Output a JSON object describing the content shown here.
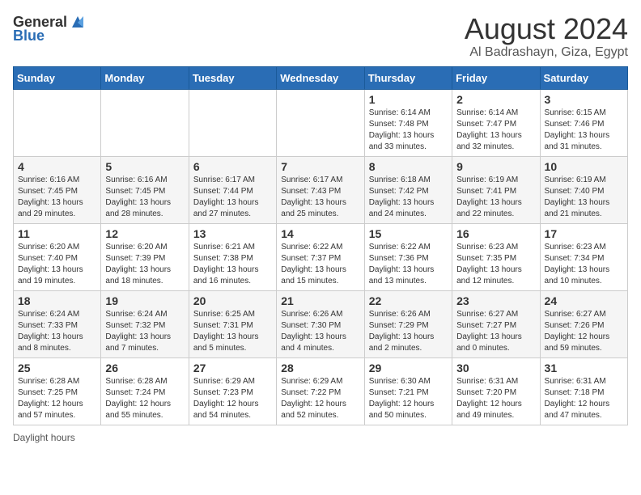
{
  "header": {
    "logo_general": "General",
    "logo_blue": "Blue",
    "title": "August 2024",
    "subtitle": "Al Badrashayn, Giza, Egypt"
  },
  "days_of_week": [
    "Sunday",
    "Monday",
    "Tuesday",
    "Wednesday",
    "Thursday",
    "Friday",
    "Saturday"
  ],
  "footer": {
    "daylight_label": "Daylight hours"
  },
  "weeks": [
    [
      {
        "day": "",
        "info": ""
      },
      {
        "day": "",
        "info": ""
      },
      {
        "day": "",
        "info": ""
      },
      {
        "day": "",
        "info": ""
      },
      {
        "day": "1",
        "info": "Sunrise: 6:14 AM\nSunset: 7:48 PM\nDaylight: 13 hours and 33 minutes."
      },
      {
        "day": "2",
        "info": "Sunrise: 6:14 AM\nSunset: 7:47 PM\nDaylight: 13 hours and 32 minutes."
      },
      {
        "day": "3",
        "info": "Sunrise: 6:15 AM\nSunset: 7:46 PM\nDaylight: 13 hours and 31 minutes."
      }
    ],
    [
      {
        "day": "4",
        "info": "Sunrise: 6:16 AM\nSunset: 7:45 PM\nDaylight: 13 hours and 29 minutes."
      },
      {
        "day": "5",
        "info": "Sunrise: 6:16 AM\nSunset: 7:45 PM\nDaylight: 13 hours and 28 minutes."
      },
      {
        "day": "6",
        "info": "Sunrise: 6:17 AM\nSunset: 7:44 PM\nDaylight: 13 hours and 27 minutes."
      },
      {
        "day": "7",
        "info": "Sunrise: 6:17 AM\nSunset: 7:43 PM\nDaylight: 13 hours and 25 minutes."
      },
      {
        "day": "8",
        "info": "Sunrise: 6:18 AM\nSunset: 7:42 PM\nDaylight: 13 hours and 24 minutes."
      },
      {
        "day": "9",
        "info": "Sunrise: 6:19 AM\nSunset: 7:41 PM\nDaylight: 13 hours and 22 minutes."
      },
      {
        "day": "10",
        "info": "Sunrise: 6:19 AM\nSunset: 7:40 PM\nDaylight: 13 hours and 21 minutes."
      }
    ],
    [
      {
        "day": "11",
        "info": "Sunrise: 6:20 AM\nSunset: 7:40 PM\nDaylight: 13 hours and 19 minutes."
      },
      {
        "day": "12",
        "info": "Sunrise: 6:20 AM\nSunset: 7:39 PM\nDaylight: 13 hours and 18 minutes."
      },
      {
        "day": "13",
        "info": "Sunrise: 6:21 AM\nSunset: 7:38 PM\nDaylight: 13 hours and 16 minutes."
      },
      {
        "day": "14",
        "info": "Sunrise: 6:22 AM\nSunset: 7:37 PM\nDaylight: 13 hours and 15 minutes."
      },
      {
        "day": "15",
        "info": "Sunrise: 6:22 AM\nSunset: 7:36 PM\nDaylight: 13 hours and 13 minutes."
      },
      {
        "day": "16",
        "info": "Sunrise: 6:23 AM\nSunset: 7:35 PM\nDaylight: 13 hours and 12 minutes."
      },
      {
        "day": "17",
        "info": "Sunrise: 6:23 AM\nSunset: 7:34 PM\nDaylight: 13 hours and 10 minutes."
      }
    ],
    [
      {
        "day": "18",
        "info": "Sunrise: 6:24 AM\nSunset: 7:33 PM\nDaylight: 13 hours and 8 minutes."
      },
      {
        "day": "19",
        "info": "Sunrise: 6:24 AM\nSunset: 7:32 PM\nDaylight: 13 hours and 7 minutes."
      },
      {
        "day": "20",
        "info": "Sunrise: 6:25 AM\nSunset: 7:31 PM\nDaylight: 13 hours and 5 minutes."
      },
      {
        "day": "21",
        "info": "Sunrise: 6:26 AM\nSunset: 7:30 PM\nDaylight: 13 hours and 4 minutes."
      },
      {
        "day": "22",
        "info": "Sunrise: 6:26 AM\nSunset: 7:29 PM\nDaylight: 13 hours and 2 minutes."
      },
      {
        "day": "23",
        "info": "Sunrise: 6:27 AM\nSunset: 7:27 PM\nDaylight: 13 hours and 0 minutes."
      },
      {
        "day": "24",
        "info": "Sunrise: 6:27 AM\nSunset: 7:26 PM\nDaylight: 12 hours and 59 minutes."
      }
    ],
    [
      {
        "day": "25",
        "info": "Sunrise: 6:28 AM\nSunset: 7:25 PM\nDaylight: 12 hours and 57 minutes."
      },
      {
        "day": "26",
        "info": "Sunrise: 6:28 AM\nSunset: 7:24 PM\nDaylight: 12 hours and 55 minutes."
      },
      {
        "day": "27",
        "info": "Sunrise: 6:29 AM\nSunset: 7:23 PM\nDaylight: 12 hours and 54 minutes."
      },
      {
        "day": "28",
        "info": "Sunrise: 6:29 AM\nSunset: 7:22 PM\nDaylight: 12 hours and 52 minutes."
      },
      {
        "day": "29",
        "info": "Sunrise: 6:30 AM\nSunset: 7:21 PM\nDaylight: 12 hours and 50 minutes."
      },
      {
        "day": "30",
        "info": "Sunrise: 6:31 AM\nSunset: 7:20 PM\nDaylight: 12 hours and 49 minutes."
      },
      {
        "day": "31",
        "info": "Sunrise: 6:31 AM\nSunset: 7:18 PM\nDaylight: 12 hours and 47 minutes."
      }
    ]
  ]
}
